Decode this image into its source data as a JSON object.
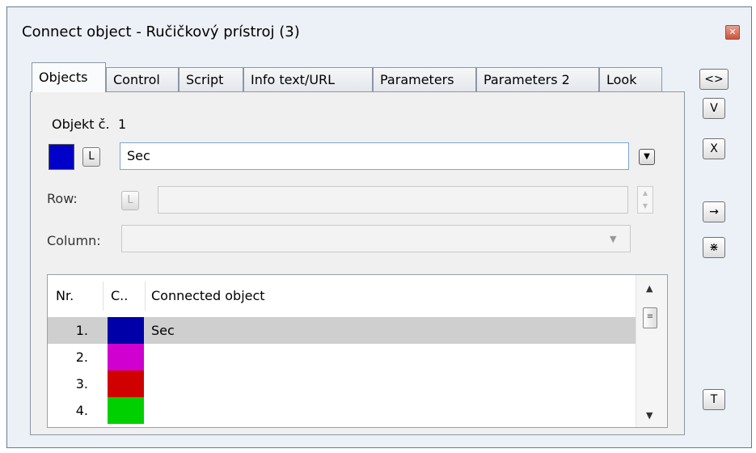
{
  "window": {
    "title": "Connect object - Ručičkový prístroj (3)",
    "close_glyph": "✕"
  },
  "tabs": [
    {
      "label": "Objects",
      "active": true
    },
    {
      "label": "Control"
    },
    {
      "label": "Script"
    },
    {
      "label": "Info text/URL"
    },
    {
      "label": "Parameters"
    },
    {
      "label": "Parameters 2"
    },
    {
      "label": "Look"
    }
  ],
  "object": {
    "label": "Objekt č.",
    "number": "1",
    "color": "#0000c8",
    "l_button": "L",
    "value": "Sec",
    "dropdown_icon": "chevron-down-icon"
  },
  "row": {
    "label": "Row:",
    "l_button": "L",
    "value": ""
  },
  "column": {
    "label": "Column:",
    "value": ""
  },
  "table": {
    "headers": [
      "Nr.",
      "C..",
      "Connected object"
    ],
    "rows": [
      {
        "nr": "1.",
        "color": "#0000a8",
        "name": "Sec",
        "selected": true
      },
      {
        "nr": "2.",
        "color": "#d000d0",
        "name": ""
      },
      {
        "nr": "3.",
        "color": "#d00000",
        "name": ""
      },
      {
        "nr": "4.",
        "color": "#00d000",
        "name": ""
      }
    ]
  },
  "side_buttons": {
    "swap": "<>",
    "v": "V",
    "x": "X",
    "arrow": "→",
    "split": "⋇",
    "t": "T"
  }
}
